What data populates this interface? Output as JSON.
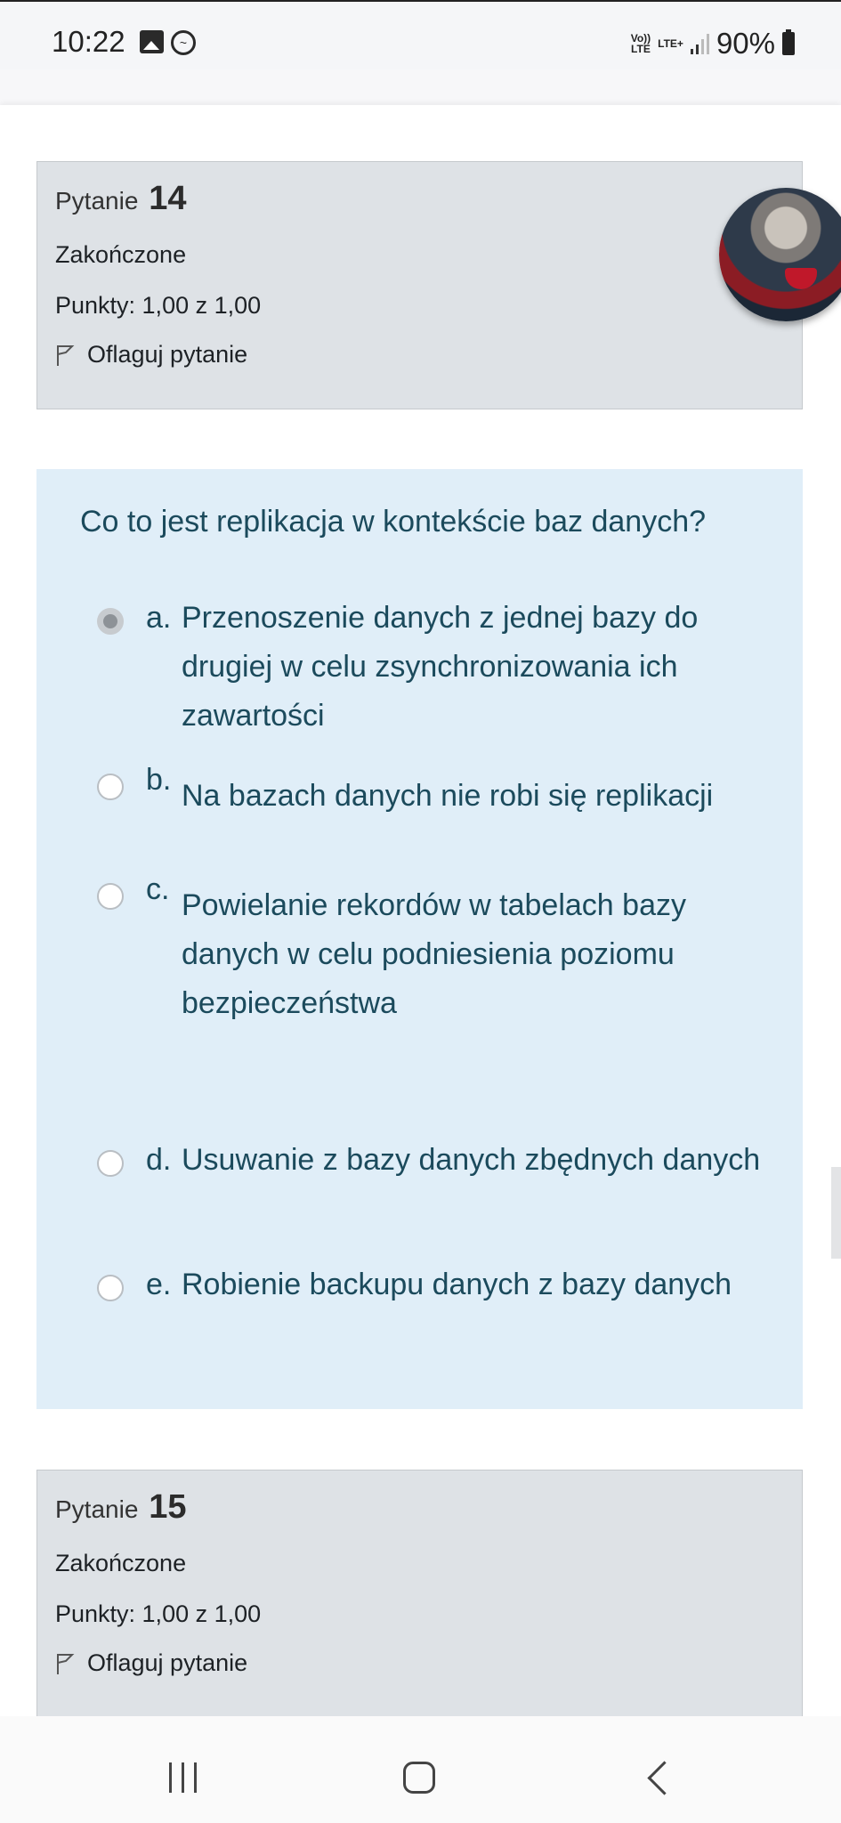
{
  "status_bar": {
    "time": "10:22",
    "volte_label": "Vo))\nLTE",
    "network_label": "LTE+",
    "battery": "90%"
  },
  "question_14": {
    "label": "Pytanie",
    "number": "14",
    "state": "Zakończone",
    "points": "Punkty: 1,00 z 1,00",
    "flag_label": "Oflaguj pytanie"
  },
  "question_text": "Co to jest replikacja w kontekście baz danych?",
  "options": [
    {
      "letter": "a.",
      "text": "Przenoszenie danych z jednej bazy do drugiej w celu zsynchronizowania ich zawartości",
      "selected": true
    },
    {
      "letter": "b.",
      "text": "Na bazach danych nie robi się replikacji",
      "selected": false
    },
    {
      "letter": "c.",
      "text": "Powielanie rekordów w tabelach bazy danych w celu podniesienia poziomu bezpieczeństwa",
      "selected": false
    },
    {
      "letter": "d.",
      "text": "Usuwanie z bazy danych zbędnych danych",
      "selected": false
    },
    {
      "letter": "e.",
      "text": "Robienie backupu danych z bazy danych",
      "selected": false
    }
  ],
  "question_15": {
    "label": "Pytanie",
    "number": "15",
    "state": "Zakończone",
    "points": "Punkty: 1,00 z 1,00",
    "flag_label": "Oflaguj pytanie"
  },
  "icons": {
    "gallery": "gallery-icon",
    "messenger": "messenger-icon",
    "signal": "signal-icon",
    "battery": "battery-icon",
    "flag": "flag-icon",
    "nav_recent": "recent-apps-icon",
    "nav_home": "home-icon",
    "nav_back": "back-icon"
  }
}
